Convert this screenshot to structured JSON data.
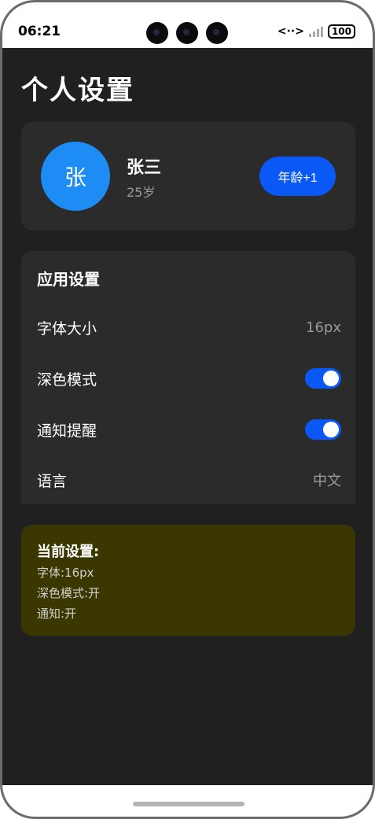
{
  "status_bar": {
    "time": "06:21",
    "network_label": "<··>",
    "battery": "100"
  },
  "page": {
    "title": "个人设置"
  },
  "profile": {
    "avatar_initial": "张",
    "name": "张三",
    "age_text": "25岁",
    "age_button": "年龄+1",
    "avatar_color": "#1e8cf5",
    "button_color": "#0a59f7"
  },
  "app_settings": {
    "title": "应用设置",
    "rows": [
      {
        "label": "字体大小",
        "value": "16px",
        "control": "text"
      },
      {
        "label": "深色模式",
        "control": "toggle",
        "on": true
      },
      {
        "label": "通知提醒",
        "control": "toggle",
        "on": true
      },
      {
        "label": "语言",
        "value": "中文",
        "control": "text"
      }
    ]
  },
  "current_settings": {
    "title": "当前设置:",
    "lines": [
      "字体:16px",
      "深色模式:开",
      "通知:开"
    ],
    "background_color": "#3a3800"
  }
}
